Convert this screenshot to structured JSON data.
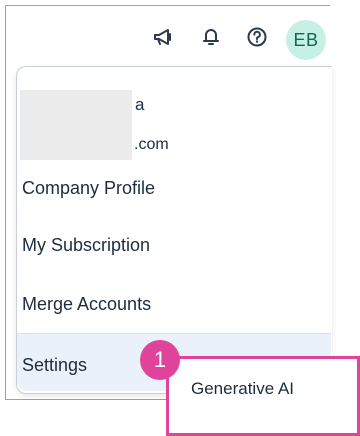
{
  "header": {
    "avatar_initials": "EB",
    "icons": [
      "megaphone-icon",
      "bell-icon",
      "help-icon"
    ]
  },
  "user": {
    "name_visible": "a",
    "email_visible": ".com"
  },
  "menu": {
    "items": [
      {
        "label": "Company Profile"
      },
      {
        "label": "My Subscription"
      },
      {
        "label": "Merge Accounts"
      }
    ],
    "settings_label": "Settings"
  },
  "submenu": {
    "item_label": "Generative AI"
  },
  "annotation": {
    "step": "1"
  },
  "colors": {
    "accent": "#e0449a",
    "avatar_bg": "#c7f0e4",
    "avatar_text": "#0a6a52",
    "settings_bg": "#eaf1fb"
  }
}
